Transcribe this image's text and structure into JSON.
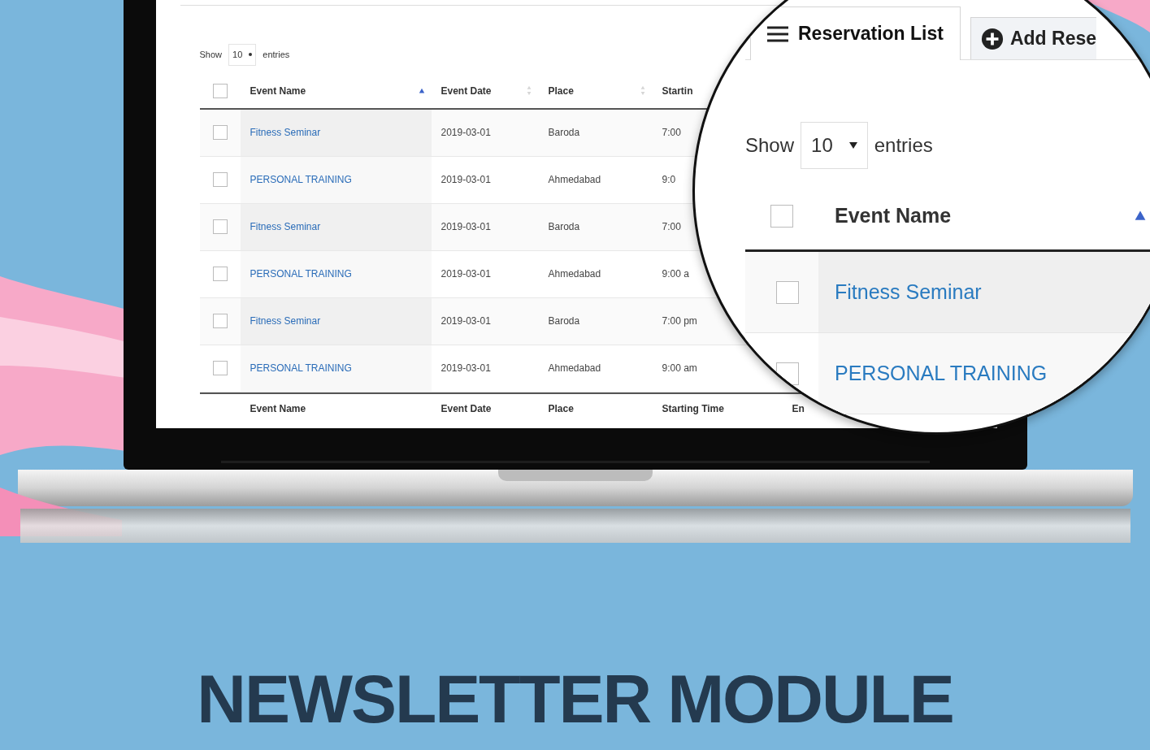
{
  "screen": {
    "length_menu": {
      "show": "Show",
      "value": "10",
      "entries": "entries"
    },
    "header_checked": false,
    "columns": [
      {
        "label": "Event Name",
        "sorted": true
      },
      {
        "label": "Event Date",
        "sorted": false
      },
      {
        "label": "Place",
        "sorted": false
      },
      {
        "label": "Startin"
      }
    ],
    "rows": [
      {
        "checked": false,
        "event_name": "Fitness Seminar",
        "event_date": "2019-03-01",
        "place": "Baroda",
        "starting_time": "7:00"
      },
      {
        "checked": false,
        "event_name": "PERSONAL TRAINING",
        "event_date": "2019-03-01",
        "place": "Ahmedabad",
        "starting_time": "9:0"
      },
      {
        "checked": false,
        "event_name": "Fitness Seminar",
        "event_date": "2019-03-01",
        "place": "Baroda",
        "starting_time": "7:00"
      },
      {
        "checked": false,
        "event_name": "PERSONAL TRAINING",
        "event_date": "2019-03-01",
        "place": "Ahmedabad",
        "starting_time": "9:00 a"
      },
      {
        "checked": false,
        "event_name": "Fitness Seminar",
        "event_date": "2019-03-01",
        "place": "Baroda",
        "starting_time": "7:00 pm"
      },
      {
        "checked": false,
        "event_name": "PERSONAL TRAINING",
        "event_date": "2019-03-01",
        "place": "Ahmedabad",
        "starting_time": "9:00 am"
      }
    ],
    "footer": [
      "Event Name",
      "Event Date",
      "Place",
      "Starting Time",
      "En"
    ]
  },
  "magnifier": {
    "tabs": [
      {
        "label": "Reservation List",
        "selected": true
      },
      {
        "label": "Add Rese",
        "selected": false
      }
    ],
    "length_menu": {
      "show": "Show",
      "value": "10",
      "entries": "entries"
    },
    "header_checked": false,
    "columns": [
      {
        "label": "Event Name",
        "sorted": true
      }
    ],
    "rows": [
      {
        "checked": false,
        "event_name": "Fitness Seminar"
      },
      {
        "checked": false,
        "event_name": "PERSONAL TRAINING"
      }
    ]
  },
  "title": "NEWSLETTER MODULE"
}
